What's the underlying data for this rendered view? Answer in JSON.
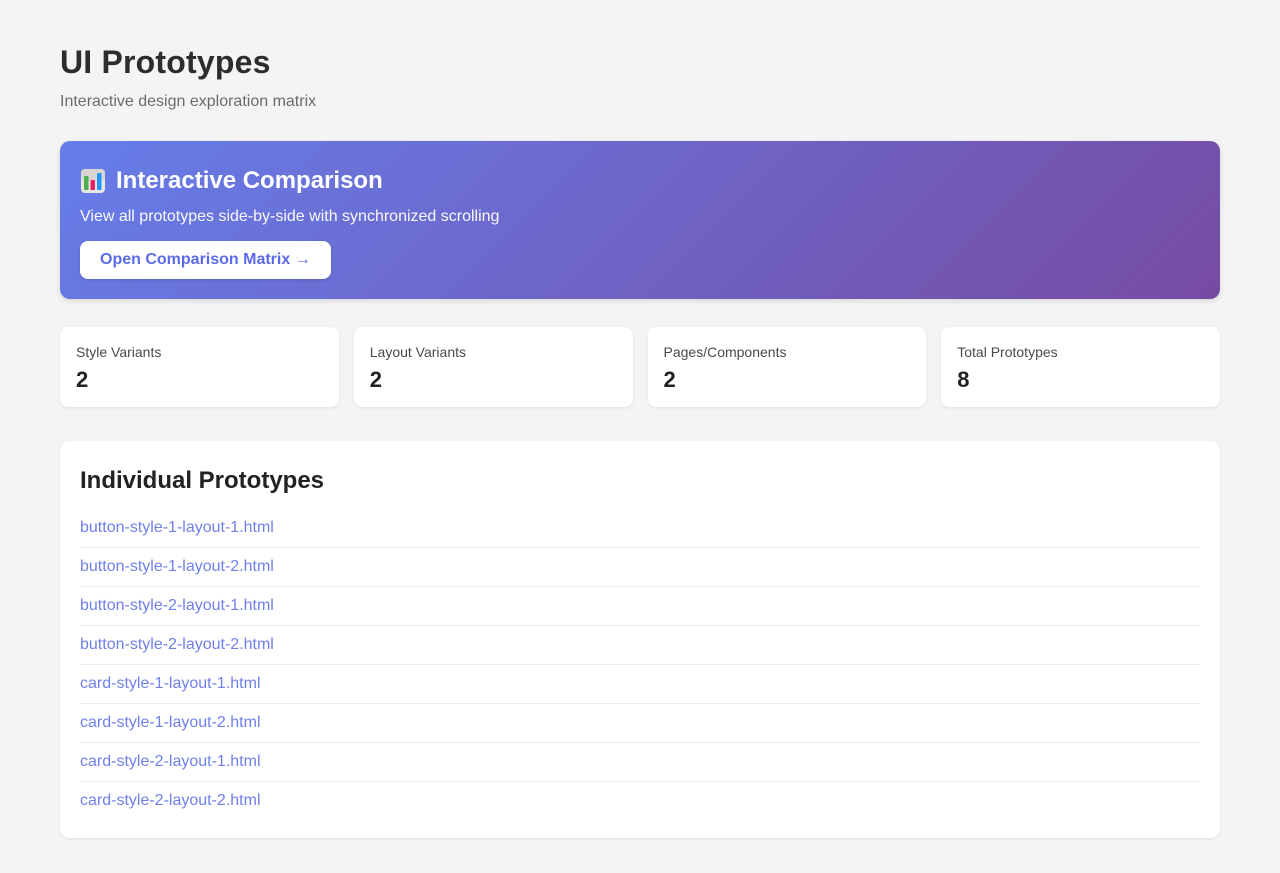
{
  "page": {
    "title": "UI Prototypes",
    "subtitle": "Interactive design exploration matrix"
  },
  "banner": {
    "icon": "bar-chart-emoji",
    "title": "Interactive Comparison",
    "description": "View all prototypes side-by-side with synchronized scrolling",
    "button_label": "Open Comparison Matrix →",
    "gradient_start": "#667eea",
    "gradient_end": "#764ba2"
  },
  "stats": [
    {
      "label": "Style Variants",
      "value": "2"
    },
    {
      "label": "Layout Variants",
      "value": "2"
    },
    {
      "label": "Pages/Components",
      "value": "2"
    },
    {
      "label": "Total Prototypes",
      "value": "8"
    }
  ],
  "prototypes": {
    "heading": "Individual Prototypes",
    "links": [
      "button-style-1-layout-1.html",
      "button-style-1-layout-2.html",
      "button-style-2-layout-1.html",
      "button-style-2-layout-2.html",
      "card-style-1-layout-1.html",
      "card-style-1-layout-2.html",
      "card-style-2-layout-1.html",
      "card-style-2-layout-2.html"
    ]
  },
  "colors": {
    "page_background": "#f4f4f5",
    "link": "#7080ea",
    "banner_text": "#ffffff"
  }
}
